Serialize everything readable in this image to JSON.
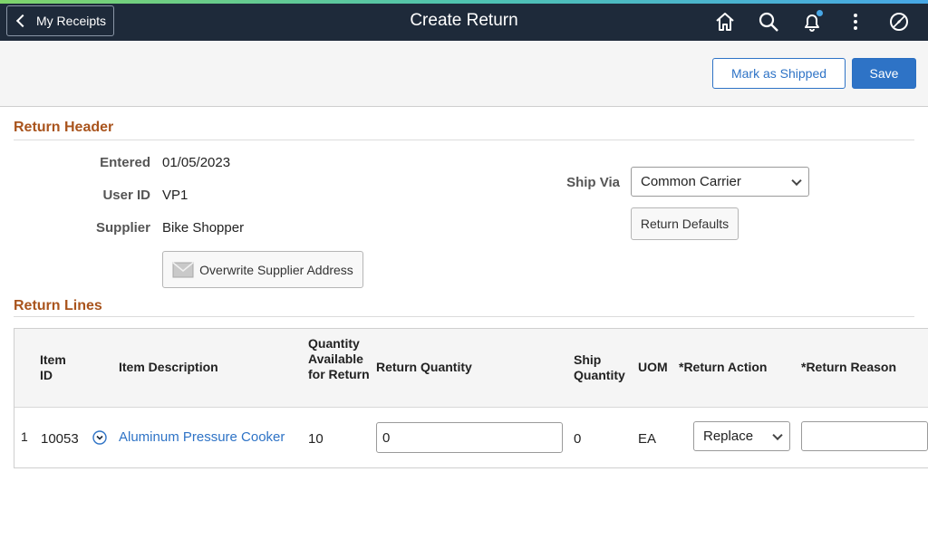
{
  "banner": {
    "back_label": "My Receipts",
    "title": "Create Return",
    "icons": [
      "home-icon",
      "search-icon",
      "bell-icon",
      "more-icon",
      "navbar-icon"
    ],
    "accent_color": "#47a7e6"
  },
  "toolbar": {
    "mark_shipped_label": "Mark as Shipped",
    "save_label": "Save"
  },
  "return_header": {
    "title": "Return Header",
    "entered_label": "Entered",
    "entered_value": "01/05/2023",
    "user_id_label": "User ID",
    "user_id_value": "VP1",
    "supplier_label": "Supplier",
    "supplier_value": "Bike Shopper",
    "overwrite_address_label": "Overwrite Supplier Address",
    "ship_via_label": "Ship Via",
    "ship_via_value": "Common Carrier",
    "return_defaults_label": "Return Defaults"
  },
  "return_lines": {
    "title": "Return Lines",
    "columns": {
      "item_id": "Item ID",
      "item_description": "Item Description",
      "quantity_available": "Quantity Available for Return",
      "return_quantity": "Return Quantity",
      "ship_quantity": "Ship Quantity",
      "uom": "UOM",
      "return_action": "*Return Action",
      "return_reason": "*Return Reason"
    },
    "rows": [
      {
        "line": "1",
        "item_id": "10053",
        "item_description": "Aluminum Pressure Cooker",
        "quantity_available": "10",
        "return_quantity": "0",
        "ship_quantity": "0",
        "uom": "EA",
        "return_action": "Replace",
        "return_reason": ""
      }
    ]
  }
}
